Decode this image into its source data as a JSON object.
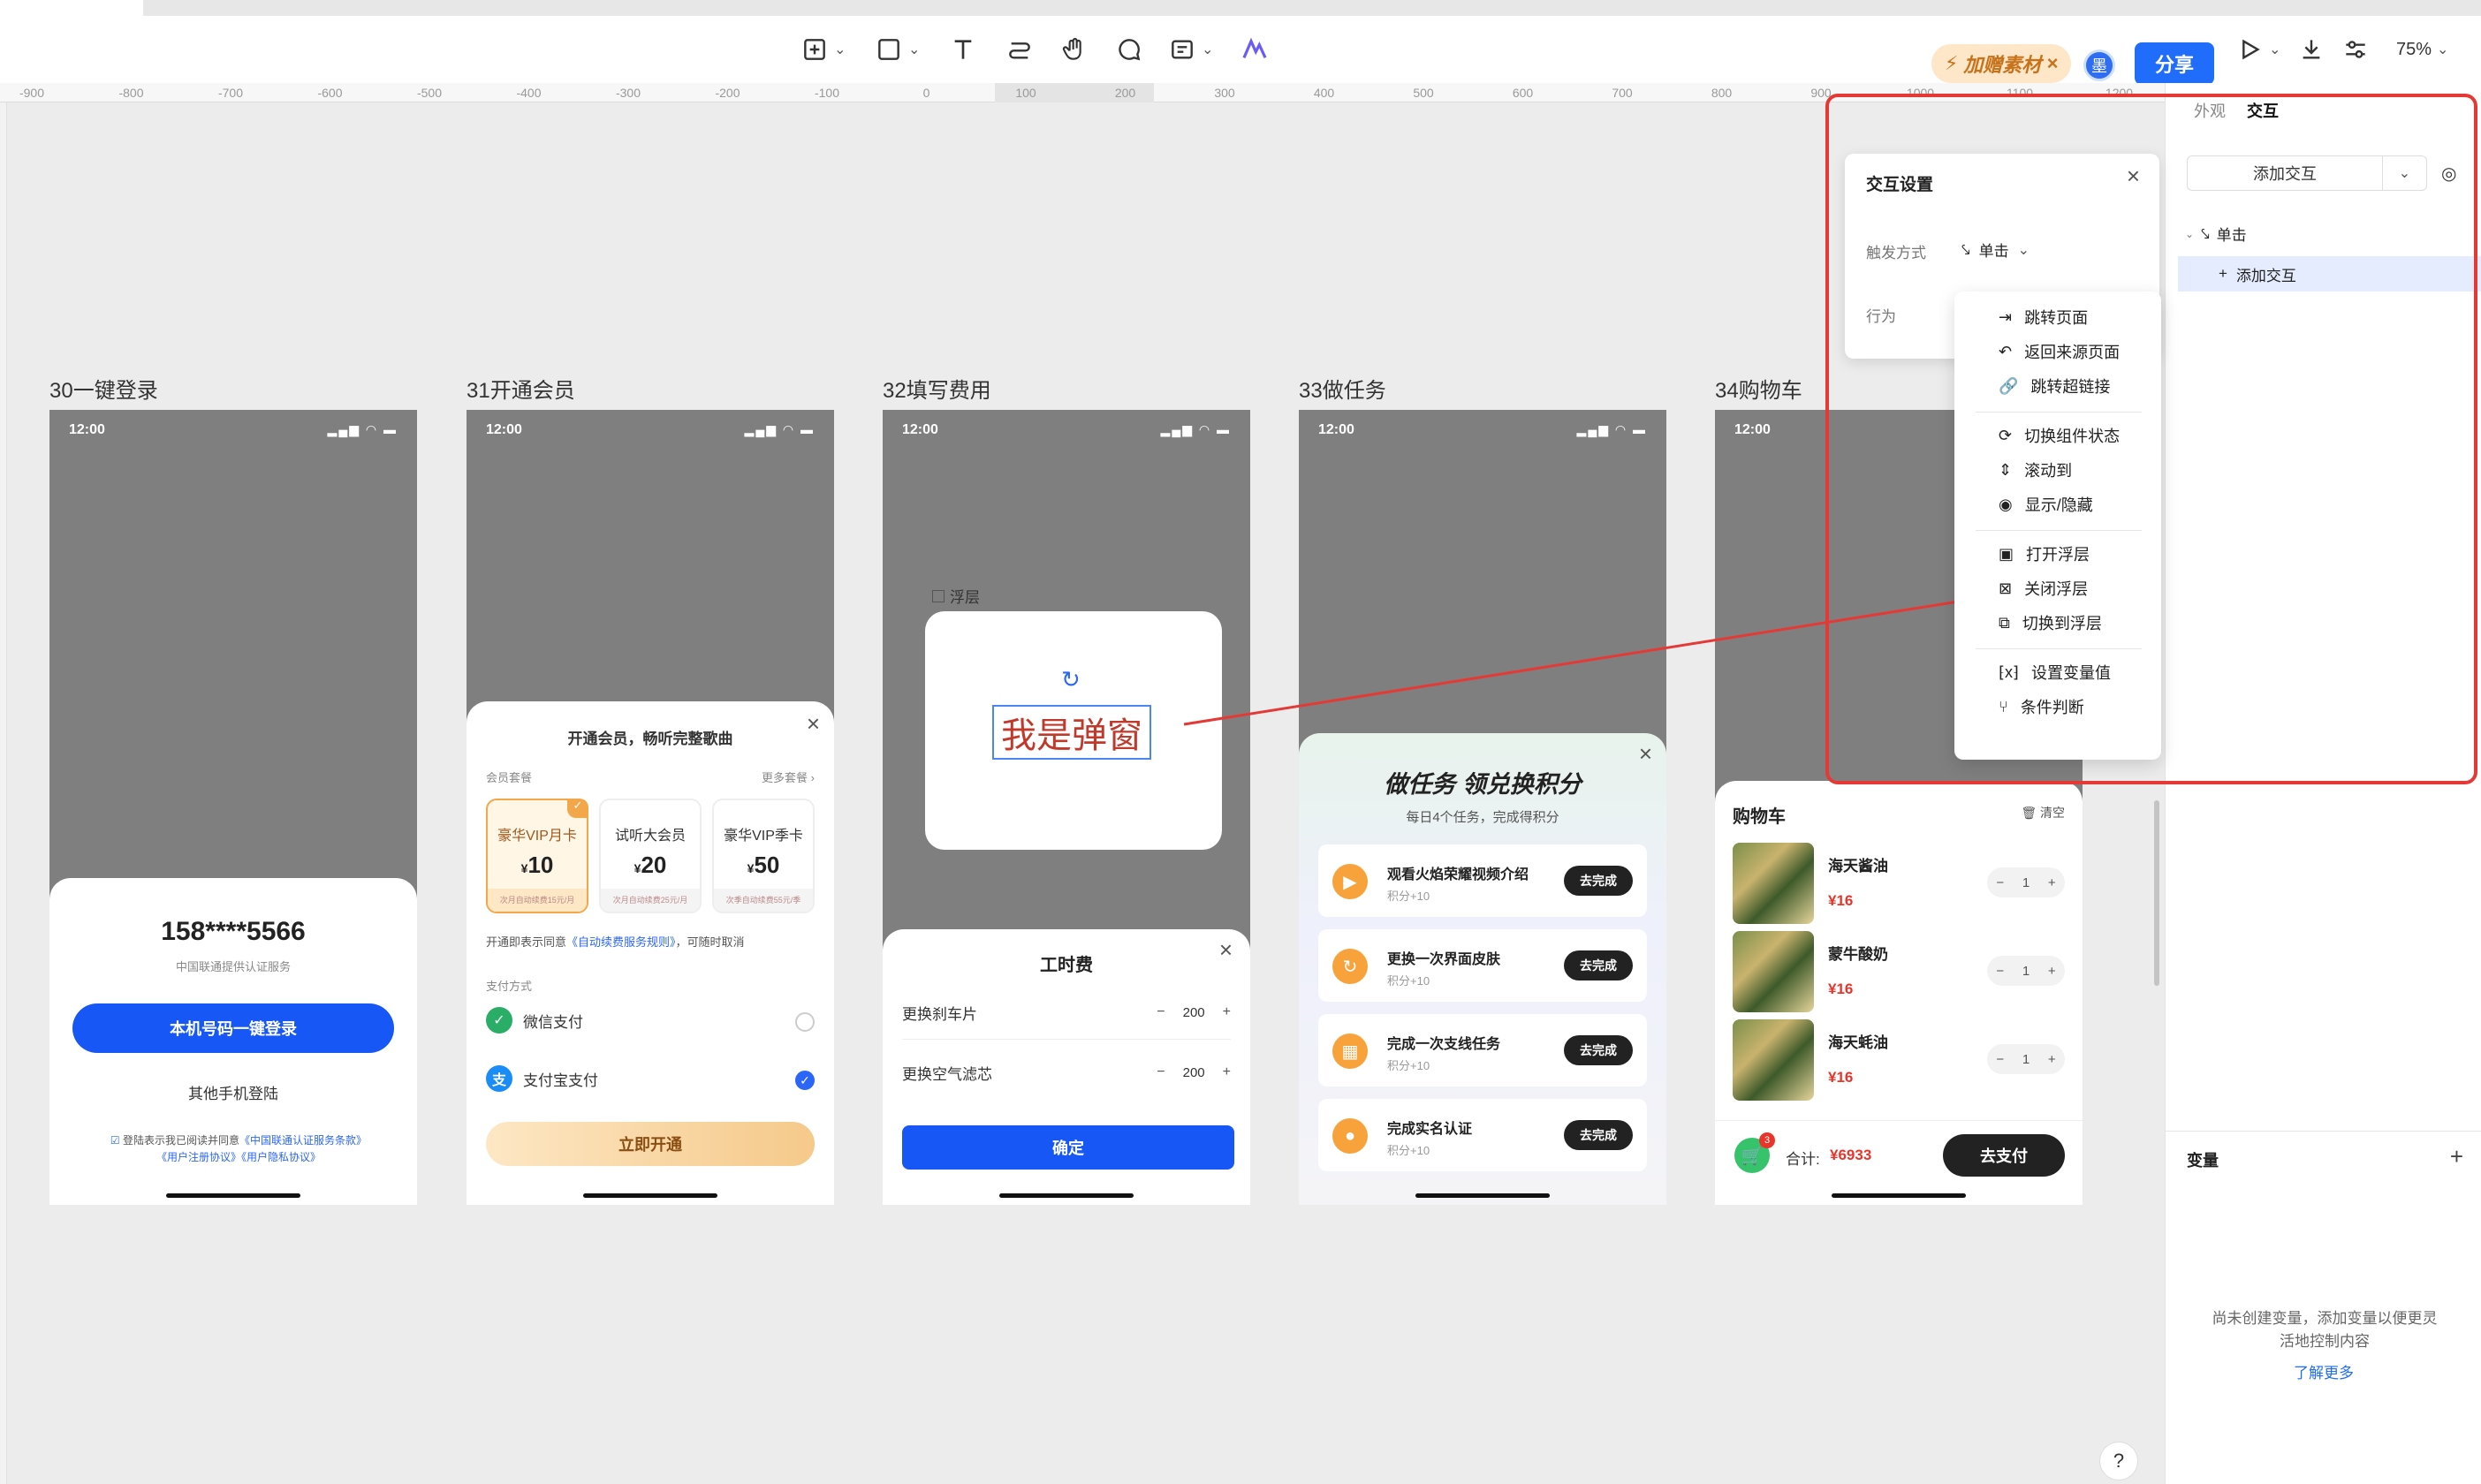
{
  "toolbar": {
    "badge_label": "加赠素材",
    "avatar_letter": "墨",
    "share_label": "分享",
    "zoom": "75%"
  },
  "ruler_marks": [
    "-900",
    "-800",
    "-700",
    "-600",
    "-500",
    "-400",
    "-300",
    "-200",
    "-100",
    "0",
    "100",
    "200",
    "300",
    "400",
    "500",
    "600",
    "700",
    "800",
    "900",
    "1000",
    "1100",
    "1200"
  ],
  "frames": {
    "f30": {
      "title": "30一键登录",
      "time": "12:00",
      "phone": "158****5566",
      "auth": "中国联通提供认证服务",
      "login_btn": "本机号码一键登录",
      "other": "其他手机登陆",
      "agree1": "登陆表示我已阅读并同意",
      "agree2": "《中国联通认证服务条款》",
      "agree3": "《用户注册协议》《用户隐私协议》"
    },
    "f31": {
      "title": "31开通会员",
      "time": "12:00",
      "sheet_title": "开通会员，畅听完整歌曲",
      "pkg_label": "会员套餐",
      "more": "更多套餐 ›",
      "cards": [
        {
          "name": "豪华VIP月卡",
          "price": "10",
          "foot": "次月自动续费15元/月"
        },
        {
          "name": "试听大会员",
          "price": "20",
          "foot": "次月自动续费25元/月"
        },
        {
          "name": "豪华VIP季卡",
          "price": "50",
          "foot": "次季自动续费55元/季"
        }
      ],
      "currency": "¥",
      "agree_pre": "开通即表示同意",
      "agree_link": "《自动续费服务规则》",
      "agree_post": "，可随时取消",
      "pay_label": "支付方式",
      "wechat": "微信支付",
      "alipay": "支付宝支付",
      "cta": "立即开通"
    },
    "f32": {
      "title": "32填写费用",
      "time": "12:00",
      "layer_label": "浮层",
      "popup_text": "我是弹窗",
      "sheet_title": "工时费",
      "row1": "更换刹车片",
      "row1_val": "200",
      "row2": "更换空气滤芯",
      "row2_val": "200",
      "confirm": "确定"
    },
    "f33": {
      "title": "33做任务",
      "time": "12:00",
      "banner_title": "做任务 领兑换积分",
      "banner_sub": "每日4个任务，完成得积分",
      "tasks": [
        {
          "title": "观看火焰荣耀视频介绍",
          "sub": "积分+10",
          "btn": "去完成"
        },
        {
          "title": "更换一次界面皮肤",
          "sub": "积分+10",
          "btn": "去完成"
        },
        {
          "title": "完成一次支线任务",
          "sub": "积分+10",
          "btn": "去完成"
        },
        {
          "title": "完成实名认证",
          "sub": "积分+10",
          "btn": "去完成"
        }
      ]
    },
    "f34": {
      "title": "34购物车",
      "time": "12:00",
      "cart_title": "购物车",
      "clear": "清空",
      "items": [
        {
          "name": "海天酱油",
          "price": "¥16",
          "qty": "1"
        },
        {
          "name": "蒙牛酸奶",
          "price": "¥16",
          "qty": "1"
        },
        {
          "name": "海天蚝油",
          "price": "¥16",
          "qty": "1"
        }
      ],
      "cart_count": "3",
      "total_label": "合计:",
      "total": "¥6933",
      "pay": "去支付"
    }
  },
  "interaction_popup": {
    "title": "交互设置",
    "trigger_label": "触发方式",
    "trigger_value": "单击",
    "action_label": "行为"
  },
  "action_menu": [
    "跳转页面",
    "返回来源页面",
    "跳转超链接",
    "切换组件状态",
    "滚动到",
    "显示/隐藏",
    "打开浮层",
    "关闭浮层",
    "切换到浮层",
    "设置变量值",
    "条件判断"
  ],
  "right_panel": {
    "tab_appearance": "外观",
    "tab_interaction": "交互",
    "add_interaction": "添加交互",
    "tree_trigger": "单击",
    "tree_add": "添加交互",
    "variables_title": "变量",
    "variables_empty": "尚未创建变量，添加变量以便更灵活地控制内容",
    "learn_more": "了解更多"
  },
  "colors": {
    "accent": "#1f6dfa",
    "highlight": "#e53935"
  }
}
